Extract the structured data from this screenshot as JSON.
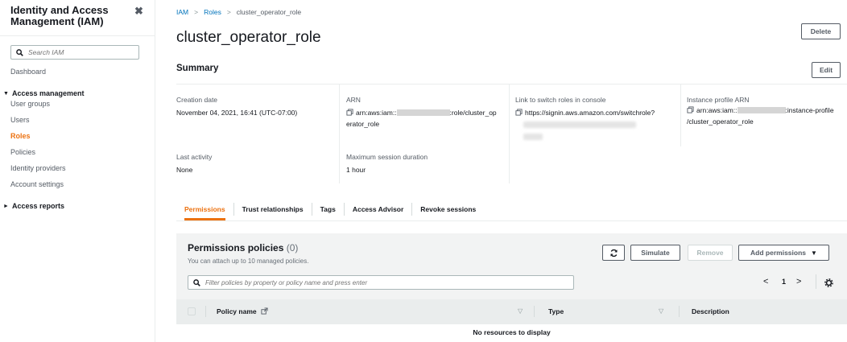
{
  "sidebar": {
    "title": "Identity and Access Management (IAM)",
    "search_placeholder": "Search IAM",
    "dashboard": "Dashboard",
    "access_management": "Access management",
    "items": [
      "User groups",
      "Users",
      "Roles",
      "Policies",
      "Identity providers",
      "Account settings"
    ],
    "access_reports": "Access reports"
  },
  "breadcrumb": {
    "iam": "IAM",
    "roles": "Roles",
    "current": "cluster_operator_role"
  },
  "page": {
    "title": "cluster_operator_role",
    "delete_label": "Delete"
  },
  "summary": {
    "heading": "Summary",
    "edit_label": "Edit",
    "creation_date_label": "Creation date",
    "creation_date": "November 04, 2021, 16:41 (UTC-07:00)",
    "arn_label": "ARN",
    "arn_prefix": "arn:aws:iam::",
    "arn_suffix": ":role/cluster_op",
    "arn_line2": "erator_role",
    "switch_label": "Link to switch roles in console",
    "switch_link": "https://signin.aws.amazon.com/switchrole?",
    "instance_profile_label": "Instance profile ARN",
    "instance_prefix": "arn:aws:iam::",
    "instance_suffix": ":instance-profile",
    "instance_line2": "/cluster_operator_role",
    "last_activity_label": "Last activity",
    "last_activity": "None",
    "max_session_label": "Maximum session duration",
    "max_session": "1 hour"
  },
  "tabs": [
    "Permissions",
    "Trust relationships",
    "Tags",
    "Access Advisor",
    "Revoke sessions"
  ],
  "permissions": {
    "title": "Permissions policies",
    "count": "(0)",
    "subtitle": "You can attach up to 10 managed policies.",
    "simulate_label": "Simulate",
    "remove_label": "Remove",
    "add_label": "Add permissions",
    "filter_placeholder": "Filter policies by property or policy name and press enter",
    "page_number": "1",
    "col_policy_name": "Policy name",
    "col_type": "Type",
    "col_description": "Description",
    "empty_message": "No resources to display"
  }
}
